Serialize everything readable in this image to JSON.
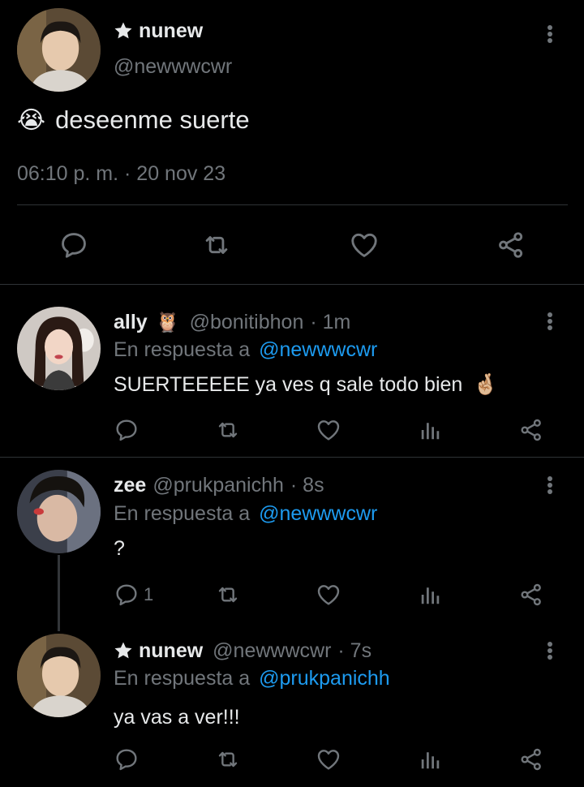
{
  "main_tweet": {
    "display_name": "nunew",
    "handle": "@newwwcwr",
    "text": "deseenme suerte",
    "emoji": "😭",
    "timestamp": "06:10 p. m. · 20 nov 23"
  },
  "replies": [
    {
      "display_name": "ally",
      "name_emoji": "🦉",
      "handle": "@bonitibhon",
      "time": "· 1m",
      "reply_prefix": "En respuesta a",
      "reply_to": "@newwwcwr",
      "text": "SUERTEEEEE ya ves q sale todo bien",
      "text_emoji": "🤞🏼"
    },
    {
      "display_name": "zee",
      "handle": "@prukpanichh",
      "time": "· 8s",
      "reply_prefix": "En respuesta a",
      "reply_to": "@newwwcwr",
      "text": "?",
      "reply_count": "1"
    },
    {
      "display_name": "nunew",
      "handle": "@newwwcwr",
      "time": "· 7s",
      "reply_prefix": "En respuesta a",
      "reply_to": "@prukpanichh",
      "text": "ya vas a ver!!!"
    }
  ],
  "colors": {
    "background": "#000000",
    "text": "#e7e9ea",
    "muted": "#71767b",
    "link": "#1d9bf0",
    "divider": "#2f3336"
  },
  "icons": [
    "star-icon",
    "more-icon",
    "reply-icon",
    "retweet-icon",
    "like-icon",
    "share-icon",
    "views-icon"
  ]
}
